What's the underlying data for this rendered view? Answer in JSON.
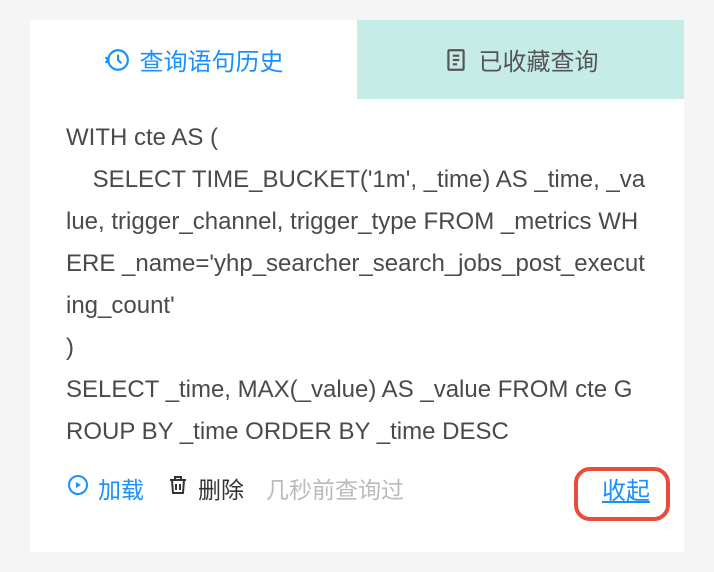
{
  "tabs": {
    "history": {
      "label": "查询语句历史"
    },
    "favorites": {
      "label": "已收藏查询"
    }
  },
  "query": {
    "text": "WITH cte AS (\n    SELECT TIME_BUCKET('1m', _time) AS _time, _value, trigger_channel, trigger_type FROM _metrics WHERE _name='yhp_searcher_search_jobs_post_executing_count'\n)\nSELECT _time, MAX(_value) AS _value FROM cte GROUP BY _time ORDER BY _time DESC"
  },
  "actions": {
    "load_label": "加载",
    "delete_label": "删除",
    "timestamp": "几秒前查询过",
    "collapse_label": "收起"
  },
  "colors": {
    "accent": "#1890ff",
    "highlight": "#e84c3d",
    "tab_inactive_bg": "#c5ece6"
  }
}
